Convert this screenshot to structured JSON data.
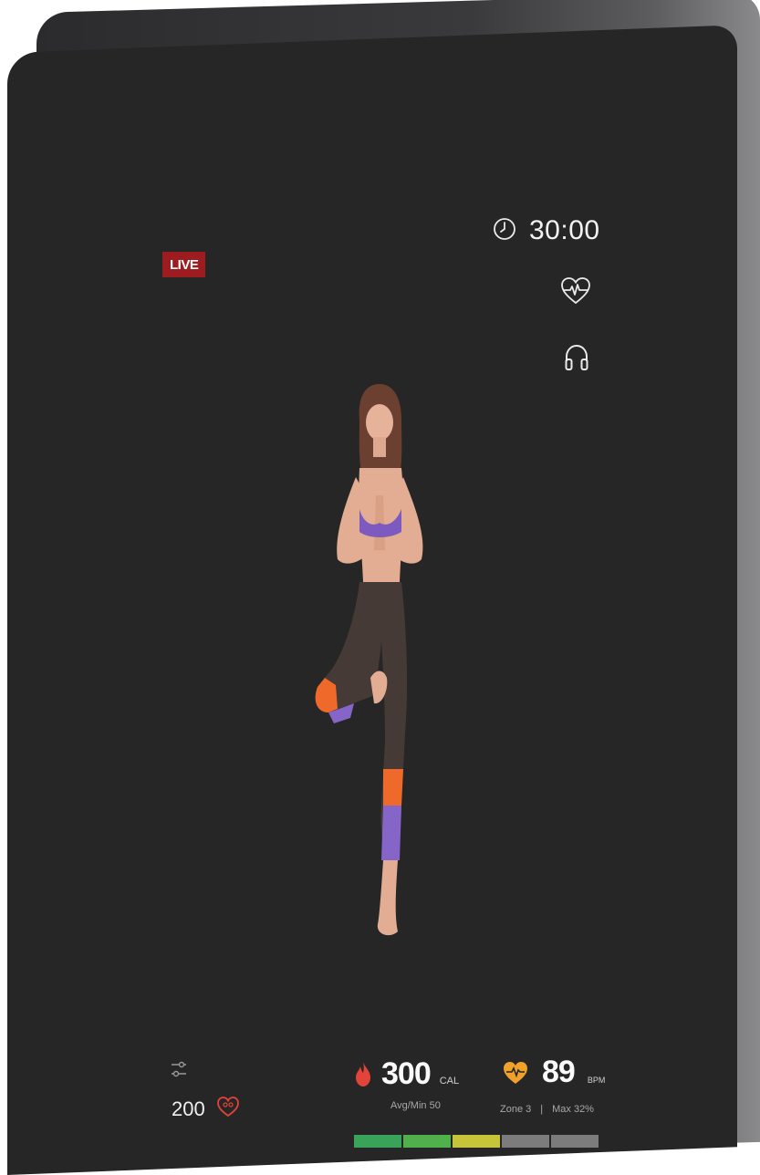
{
  "overlay": {
    "live_label": "LIVE",
    "timer": "30:00",
    "icons": [
      "clock-icon",
      "heart-rate-icon",
      "headphones-icon",
      "settings-sliders-icon",
      "heart-goal-icon",
      "flame-icon",
      "heart-zone-icon"
    ]
  },
  "stats": {
    "goal_value": "200",
    "calories_value": "300",
    "calories_unit": "CAL",
    "avg_per_min": "Avg/Min  50",
    "heart_rate_value": "89",
    "heart_rate_unit": "BPM",
    "zone_label": "Zone 3",
    "zone_separator": "|",
    "max_label": "Max 32%",
    "zone_colors": [
      "#3aa35a",
      "#4fb04c",
      "#c8c43a",
      "#7c7c7c",
      "#7c7c7c"
    ]
  },
  "colors": {
    "live": "#9c1c1f",
    "flame": "#e2433a",
    "heart_zone": "#f0a12b",
    "goal_heart": "#e2433a"
  }
}
